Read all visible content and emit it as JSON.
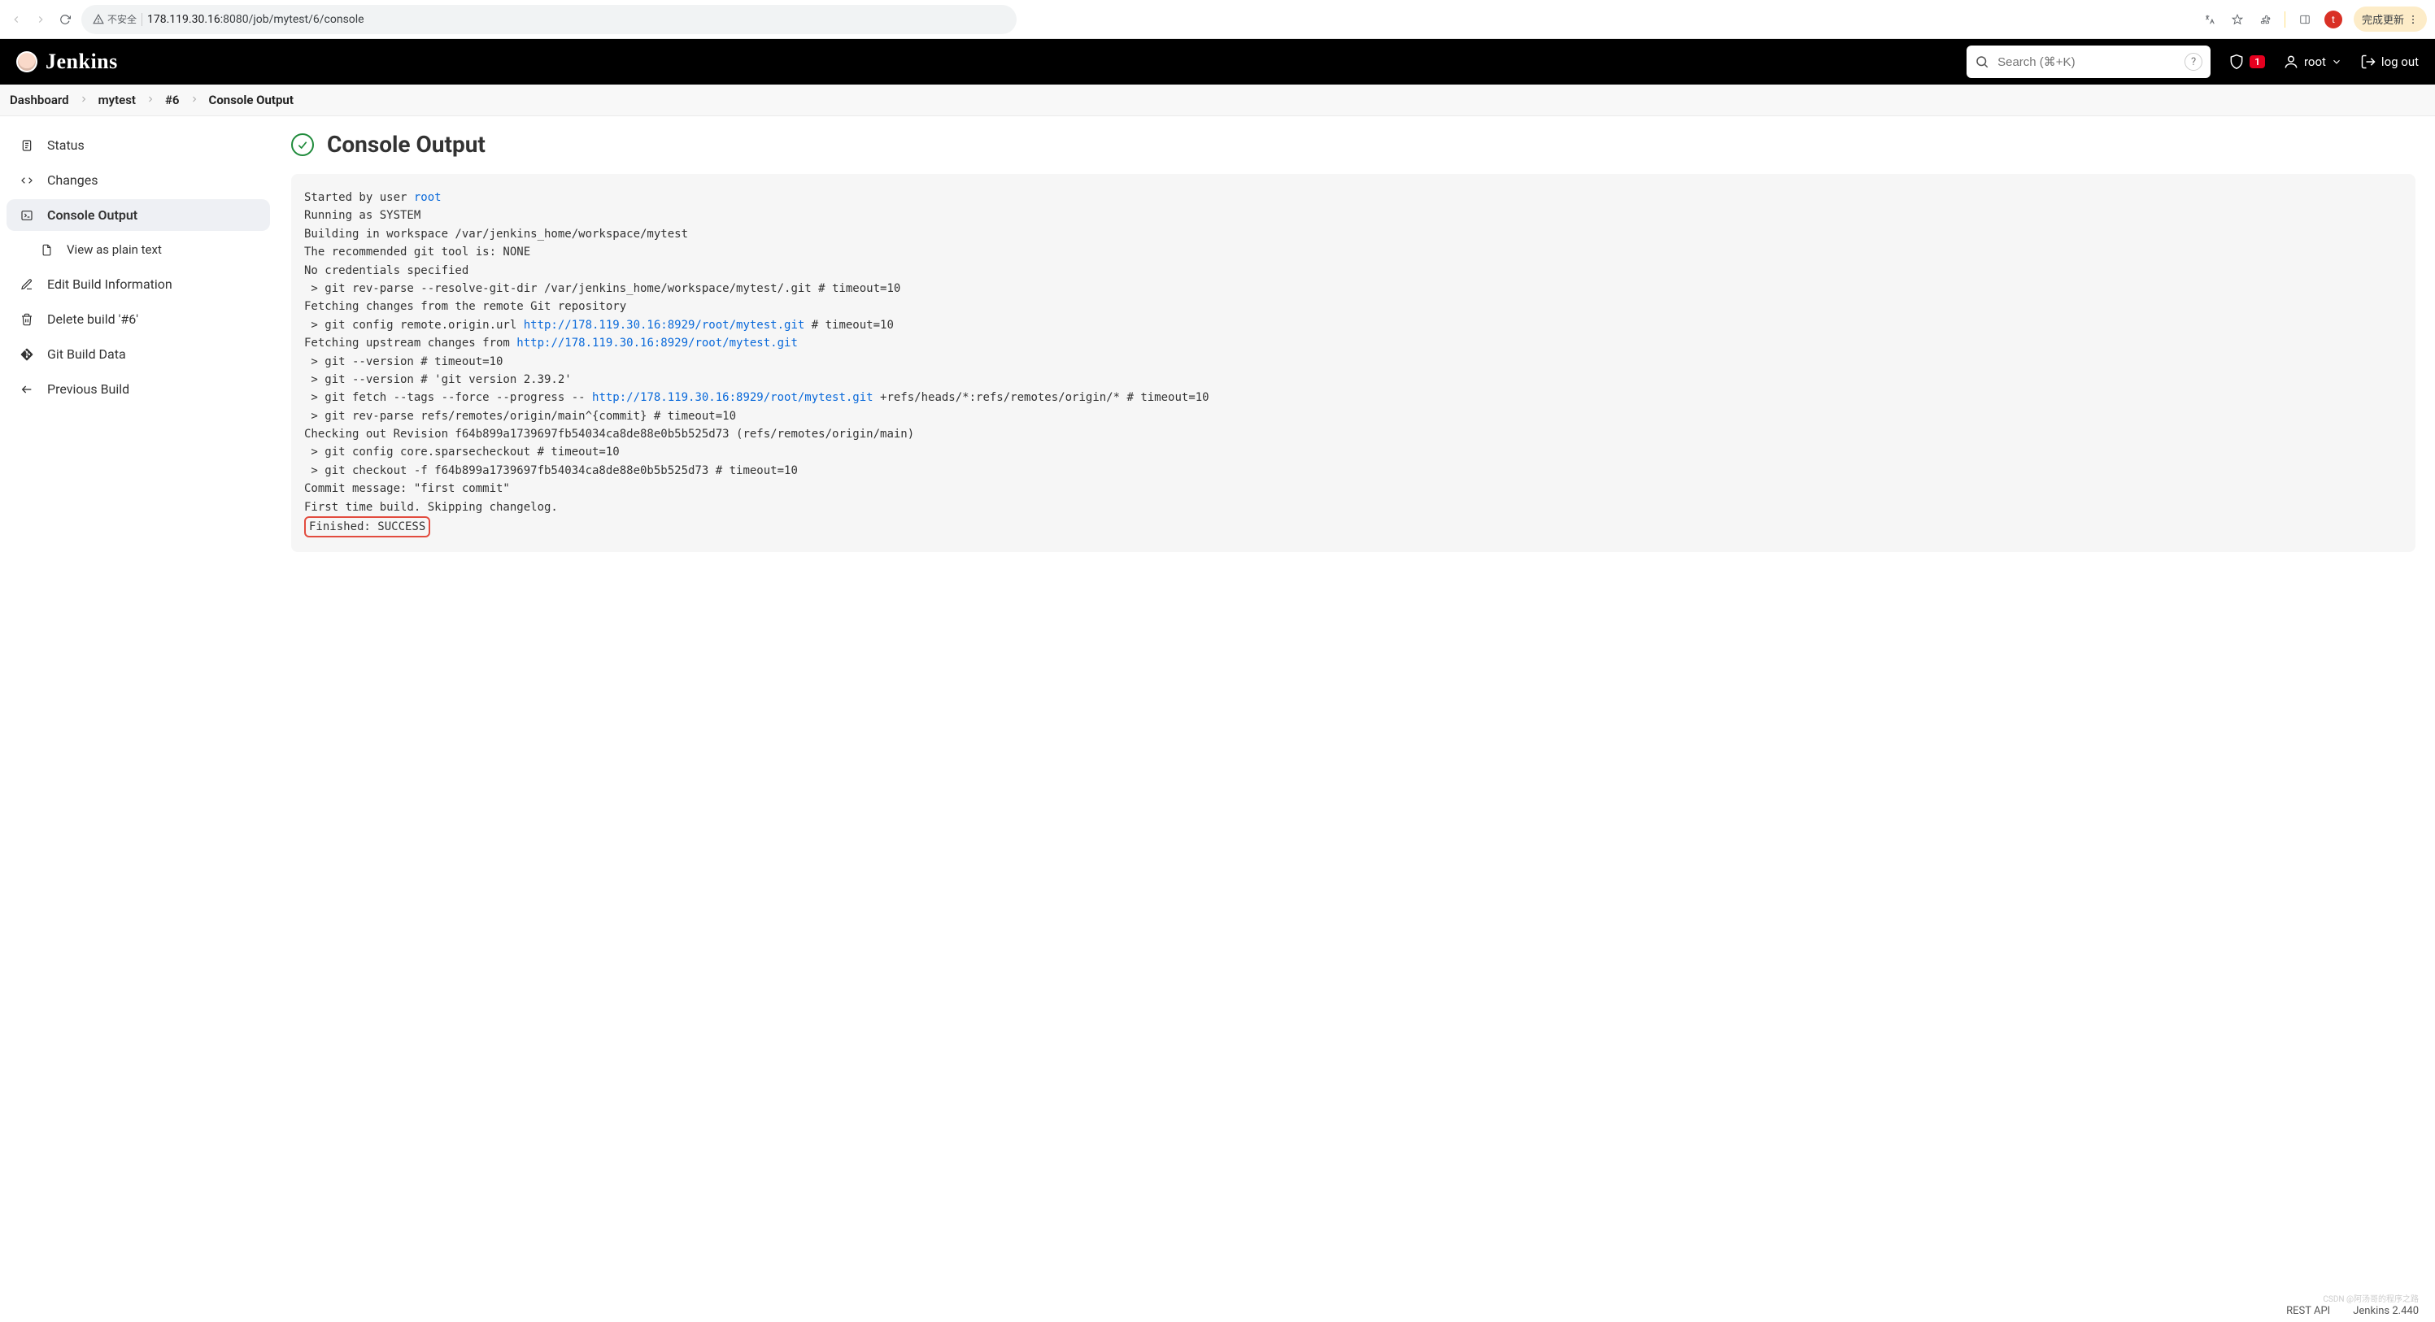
{
  "browser": {
    "insecure_label": "不安全",
    "url_host": "178.119.30.16",
    "url_path": ":8080/job/mytest/6/console",
    "avatar_initial": "t",
    "update_label": "完成更新"
  },
  "header": {
    "brand": "Jenkins",
    "search_placeholder": "Search (⌘+K)",
    "alert_count": "1",
    "user": "root",
    "logout": "log out"
  },
  "breadcrumbs": [
    {
      "label": "Dashboard"
    },
    {
      "label": "mytest"
    },
    {
      "label": "#6"
    },
    {
      "label": "Console Output",
      "current": true
    }
  ],
  "sidebar": {
    "items": [
      {
        "icon": "status",
        "label": "Status"
      },
      {
        "icon": "changes",
        "label": "Changes"
      },
      {
        "icon": "console",
        "label": "Console Output",
        "active": true
      },
      {
        "icon": "doc",
        "label": "View as plain text",
        "sub": true
      },
      {
        "icon": "edit",
        "label": "Edit Build Information"
      },
      {
        "icon": "trash",
        "label": "Delete build '#6'"
      },
      {
        "icon": "git",
        "label": "Git Build Data"
      },
      {
        "icon": "back",
        "label": "Previous Build"
      }
    ]
  },
  "page": {
    "title": "Console Output"
  },
  "console": {
    "seg1": "Started by user ",
    "user_link": "root",
    "seg2": "\nRunning as SYSTEM\nBuilding in workspace /var/jenkins_home/workspace/mytest\nThe recommended git tool is: NONE\nNo credentials specified\n > git rev-parse --resolve-git-dir /var/jenkins_home/workspace/mytest/.git # timeout=10\nFetching changes from the remote Git repository\n > git config remote.origin.url ",
    "url1": "http://178.119.30.16:8929/root/mytest.git",
    "seg3": " # timeout=10\nFetching upstream changes from ",
    "url2": "http://178.119.30.16:8929/root/mytest.git",
    "seg4": "\n > git --version # timeout=10\n > git --version # 'git version 2.39.2'\n > git fetch --tags --force --progress -- ",
    "url3": "http://178.119.30.16:8929/root/mytest.git",
    "seg5": " +refs/heads/*:refs/remotes/origin/* # timeout=10\n > git rev-parse refs/remotes/origin/main^{commit} # timeout=10\nChecking out Revision f64b899a1739697fb54034ca8de88e0b5b525d73 (refs/remotes/origin/main)\n > git config core.sparsecheckout # timeout=10\n > git checkout -f f64b899a1739697fb54034ca8de88e0b5b525d73 # timeout=10\nCommit message: \"first commit\"\nFirst time build. Skipping changelog.\n",
    "finished": "Finished: SUCCESS"
  },
  "footer": {
    "rest_api": "REST API",
    "version": "Jenkins 2.440"
  },
  "watermark": "CSDN @阿汤哥的程序之路"
}
